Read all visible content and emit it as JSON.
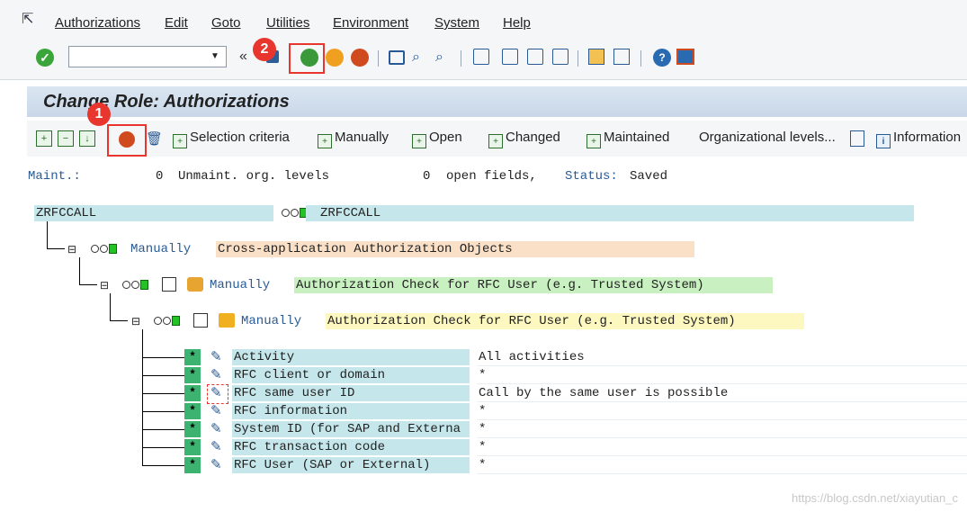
{
  "menubar": {
    "items": [
      "Authorizations",
      "Edit",
      "Goto",
      "Utilities",
      "Environment",
      "System",
      "Help"
    ]
  },
  "toolbar": {
    "command_value": "",
    "collapse_glyph": "«",
    "icons": [
      "save-icon",
      "back-icon",
      "exit-icon",
      "cancel-icon",
      "print-icon",
      "find-icon",
      "find-next-icon",
      "first-page-icon",
      "previous-page-icon",
      "next-page-icon",
      "last-page-icon",
      "create-session-icon",
      "shortcut-icon",
      "help-icon",
      "customize-layout-icon"
    ]
  },
  "markers": {
    "one": "1",
    "two": "2"
  },
  "title": "Change Role: Authorizations",
  "app_toolbar": {
    "selection_criteria": "Selection criteria",
    "manually": "Manually",
    "open": "Open",
    "changed": "Changed",
    "maintained": "Maintained",
    "org_levels": "Organizational levels...",
    "information": "Information"
  },
  "status": {
    "maint_label": "Maint.:",
    "unmaint_count": "0",
    "unmaint_text": "Unmaint. org. levels",
    "open_count": "0",
    "open_text": "open fields,",
    "status_label": "Status:",
    "status_value": "Saved"
  },
  "tree": {
    "role_name": "ZRFCCALL",
    "role_name_right": "ZRFCCALL",
    "level1": {
      "mode": "Manually",
      "text": "Cross-application Authorization Objects"
    },
    "level2": {
      "mode": "Manually",
      "text": "Authorization Check for RFC User (e.g. Trusted System)"
    },
    "level3": {
      "mode": "Manually",
      "text": "Authorization Check for RFC User (e.g. Trusted System)"
    },
    "fields": [
      {
        "star": "*",
        "name": "Activity",
        "value": "All activities"
      },
      {
        "star": "*",
        "name": "RFC client or domain",
        "value": "*"
      },
      {
        "star": "*",
        "name": "RFC same user ID",
        "value": "Call by the same user is possible"
      },
      {
        "star": "*",
        "name": "RFC information",
        "value": "*"
      },
      {
        "star": "*",
        "name": "System ID (for SAP and Externa",
        "value": "*"
      },
      {
        "star": "*",
        "name": "RFC transaction code",
        "value": "*"
      },
      {
        "star": "*",
        "name": "RFC User (SAP or External)",
        "value": "*"
      }
    ]
  },
  "colors": {
    "level1_bg": "#fbe0c8",
    "level2_bg": "#c8f0c0",
    "level3_bg": "#fdf7c0",
    "highlight": "#e8362f"
  },
  "watermark": "https://blog.csdn.net/xiayutian_c"
}
